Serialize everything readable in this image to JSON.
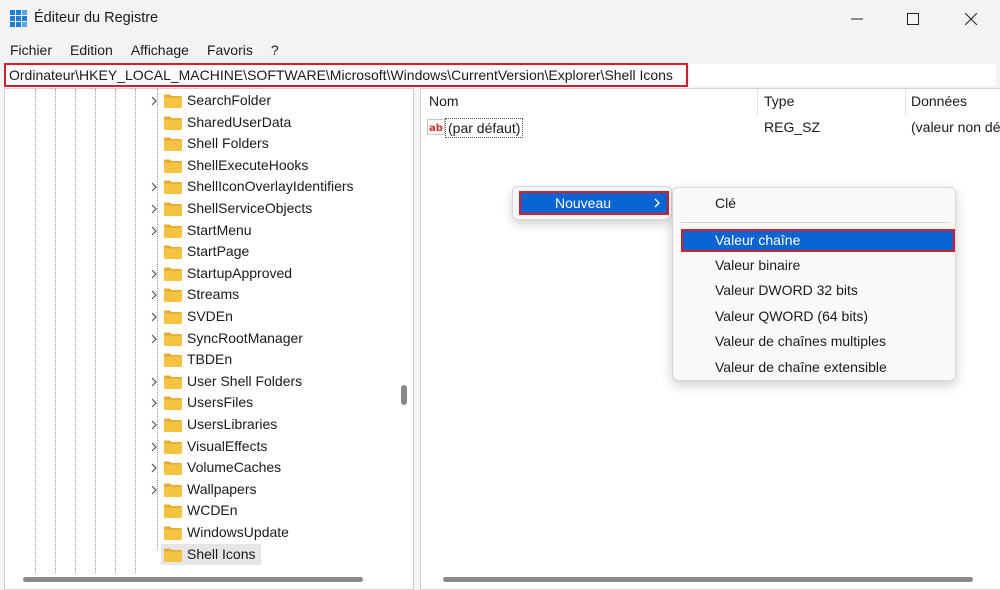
{
  "window": {
    "title": "Éditeur du Registre"
  },
  "menubar": {
    "items": [
      "Fichier",
      "Edition",
      "Affichage",
      "Favoris",
      "?"
    ]
  },
  "address": {
    "path": "Ordinateur\\HKEY_LOCAL_MACHINE\\SOFTWARE\\Microsoft\\Windows\\CurrentVersion\\Explorer\\Shell Icons"
  },
  "tree": {
    "items": [
      {
        "label": "SearchFolder",
        "expandable": true
      },
      {
        "label": "SharedUserData",
        "expandable": false
      },
      {
        "label": "Shell Folders",
        "expandable": false
      },
      {
        "label": "ShellExecuteHooks",
        "expandable": false
      },
      {
        "label": "ShellIconOverlayIdentifiers",
        "expandable": true
      },
      {
        "label": "ShellServiceObjects",
        "expandable": true
      },
      {
        "label": "StartMenu",
        "expandable": true
      },
      {
        "label": "StartPage",
        "expandable": false
      },
      {
        "label": "StartupApproved",
        "expandable": true
      },
      {
        "label": "Streams",
        "expandable": true
      },
      {
        "label": "SVDEn",
        "expandable": true
      },
      {
        "label": "SyncRootManager",
        "expandable": true
      },
      {
        "label": "TBDEn",
        "expandable": false
      },
      {
        "label": "User Shell Folders",
        "expandable": true
      },
      {
        "label": "UsersFiles",
        "expandable": true
      },
      {
        "label": "UsersLibraries",
        "expandable": true
      },
      {
        "label": "VisualEffects",
        "expandable": true
      },
      {
        "label": "VolumeCaches",
        "expandable": true
      },
      {
        "label": "Wallpapers",
        "expandable": true
      },
      {
        "label": "WCDEn",
        "expandable": false
      },
      {
        "label": "WindowsUpdate",
        "expandable": false
      },
      {
        "label": "Shell Icons",
        "expandable": false,
        "selected": true
      }
    ]
  },
  "list": {
    "columns": [
      "Nom",
      "Type",
      "Données"
    ],
    "rows": [
      {
        "icon": "string-value-icon",
        "name": "(par défaut)",
        "type": "REG_SZ",
        "data": "(valeur non dé"
      }
    ]
  },
  "context_menu": {
    "new_label": "Nouveau"
  },
  "submenu": {
    "items": [
      "Clé",
      "Valeur chaîne",
      "Valeur binaire",
      "Valeur DWORD 32 bits",
      "Valeur QWORD (64 bits)",
      "Valeur de chaînes multiples",
      "Valeur de chaîne extensible"
    ],
    "highlighted": "Valeur chaîne"
  },
  "colors": {
    "accent": "#0a64d2",
    "highlight_border": "#d21f2d",
    "folder": "#f5c342"
  }
}
